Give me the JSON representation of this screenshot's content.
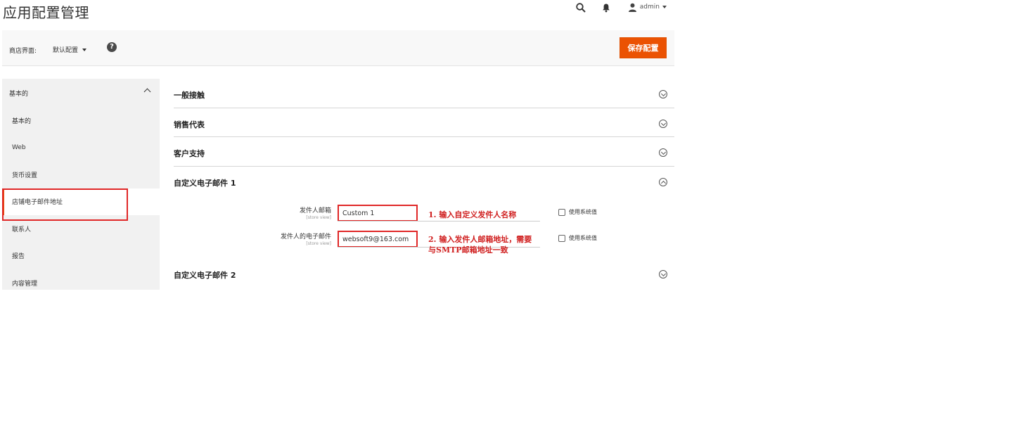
{
  "header": {
    "title": "应用配置管理",
    "user": "admin"
  },
  "scope": {
    "label": "商店界面:",
    "value": "默认配置",
    "help": "?"
  },
  "toolbar": {
    "save_label": "保存配置",
    "accent": "#eb5202"
  },
  "sidebar": {
    "section": "基本的",
    "items": [
      {
        "label": "基本的"
      },
      {
        "label": "Web"
      },
      {
        "label": "货币设置"
      },
      {
        "label": "店铺电子邮件地址"
      },
      {
        "label": "联系人"
      },
      {
        "label": "报告"
      },
      {
        "label": "内容管理"
      }
    ]
  },
  "groups": [
    {
      "label": "一般接触"
    },
    {
      "label": "销售代表"
    },
    {
      "label": "客户支持"
    },
    {
      "label": "自定义电子邮件 1"
    },
    {
      "label": "自定义电子邮件 2"
    }
  ],
  "fields": {
    "sender_name": {
      "label": "发件人邮箱",
      "scope": "[store view]",
      "value": "Custom 1",
      "system_label": "使用系统值"
    },
    "sender_email": {
      "label": "发件人的电子邮件",
      "scope": "[store view]",
      "value": "websoft9@163.com",
      "system_label": "使用系统值"
    }
  },
  "annotations": {
    "first": "1. 输入自定义发件人名称",
    "second_line1": "2. 输入发件人邮箱地址，需要",
    "second_line2": "与SMTP邮箱地址一致"
  }
}
